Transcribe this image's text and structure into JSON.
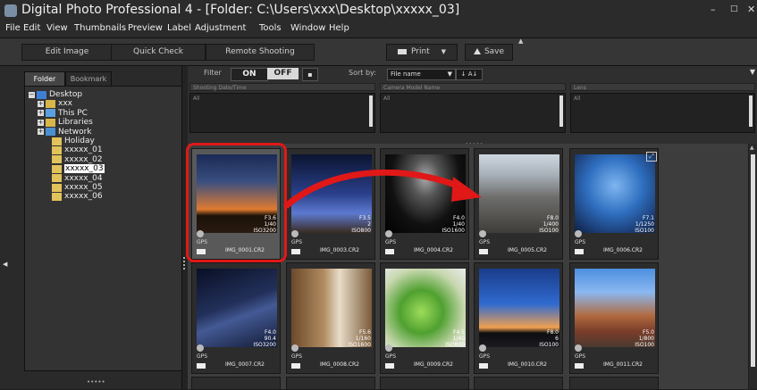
{
  "window": {
    "title": "Digital Photo Professional 4 - [Folder: C:\\Users\\xxx\\Desktop\\xxxxx_03]",
    "minimize": "–",
    "maximize": "□",
    "close": "✕"
  },
  "menu": [
    "File",
    "Edit",
    "View",
    "Thumbnails",
    "Preview",
    "Label",
    "Adjustment",
    "Tools",
    "Window",
    "Help"
  ],
  "toolbar": {
    "edit_image": "Edit Image",
    "quick_check": "Quick Check",
    "remote_shooting": "Remote Shooting",
    "print": "Print",
    "print_dropdown": "▼",
    "save": "Save"
  },
  "left_panel": {
    "tabs": [
      "Folder",
      "Bookmark"
    ],
    "tree": [
      {
        "label": "Desktop",
        "icon": "desktop-icon",
        "expander": "−"
      },
      {
        "label": "xxx",
        "icon": "user-folder-icon",
        "expander": "+"
      },
      {
        "label": "This PC",
        "icon": "computer-icon",
        "expander": "+"
      },
      {
        "label": "Libraries",
        "icon": "libraries-icon",
        "expander": "+"
      },
      {
        "label": "Network",
        "icon": "network-icon",
        "expander": "+"
      },
      {
        "label": "Holiday",
        "icon": "folder-icon",
        "expander": ""
      },
      {
        "label": "xxxxx_01",
        "icon": "folder-icon",
        "expander": ""
      },
      {
        "label": "xxxxx_02",
        "icon": "folder-icon",
        "expander": ""
      },
      {
        "label": "xxxxx_03",
        "icon": "folder-icon",
        "expander": "",
        "selected": true
      },
      {
        "label": "xxxxx_04",
        "icon": "folder-icon",
        "expander": ""
      },
      {
        "label": "xxxxx_05",
        "icon": "folder-icon",
        "expander": ""
      },
      {
        "label": "xxxxx_06",
        "icon": "folder-icon",
        "expander": ""
      }
    ]
  },
  "filter_bar": {
    "filter_label": "Filter",
    "on": "ON",
    "off": "OFF",
    "sort_label": "Sort by:",
    "sort_value": "File name",
    "sort_direction": "↓ A↓"
  },
  "filter_groups": [
    {
      "header": "Shooting Date/Time",
      "item": "All"
    },
    {
      "header": "Camera Model Name",
      "item": "All"
    },
    {
      "header": "Lens",
      "item": "All"
    }
  ],
  "thumbnails": [
    {
      "file": "IMG_0001.CR2",
      "exif": "F3.6\n1/40\nISO3200",
      "gps": "GPS",
      "selected": true,
      "palette": "sunset-baobab"
    },
    {
      "file": "IMG_0003.CR2",
      "exif": "F3.5\n2\nISO800",
      "gps": "GPS",
      "selected": false,
      "palette": "night-baobab"
    },
    {
      "file": "IMG_0004.CR2",
      "exif": "F4.0\n1/40\nISO1600",
      "gps": "GPS",
      "selected": false,
      "palette": "dark-rock"
    },
    {
      "file": "IMG_0005.CR2",
      "exif": "F8.0\n1/400\nISO100",
      "gps": "GPS",
      "selected": false,
      "palette": "limestone"
    },
    {
      "file": "IMG_0006.CR2",
      "exif": "F7.1\n1/1250\nISO100",
      "gps": "GPS",
      "selected": false,
      "palette": "fisheye-sky"
    },
    {
      "file": "IMG_0007.CR2",
      "exif": "F4.0\n90.4\nISO3200",
      "gps": "GPS",
      "selected": false,
      "palette": "milkyway"
    },
    {
      "file": "IMG_0008.CR2",
      "exif": "F5.6\n1/160\nISO1600",
      "gps": "GPS",
      "selected": false,
      "palette": "lemur"
    },
    {
      "file": "IMG_0009.CR2",
      "exif": "F4.5\n1/40\nISO800",
      "gps": "GPS",
      "selected": false,
      "palette": "chameleon"
    },
    {
      "file": "IMG_0010.CR2",
      "exif": "F8.0\n6\nISO100",
      "gps": "GPS",
      "selected": false,
      "palette": "dusk-baobab"
    },
    {
      "file": "IMG_0011.CR2",
      "exif": "F5.0\n1/800\nISO100",
      "gps": "GPS",
      "selected": false,
      "palette": "village"
    }
  ],
  "colors": {
    "highlight": "#e01818",
    "selected_thumb": "#595959"
  }
}
